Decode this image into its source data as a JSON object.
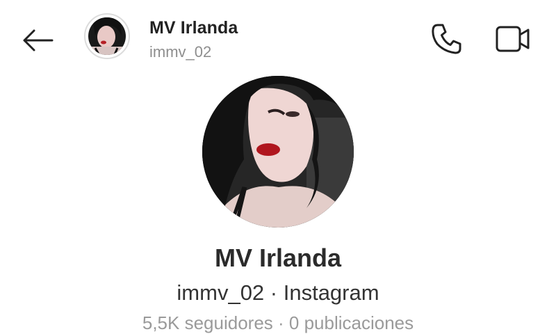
{
  "header": {
    "name": "MV Irlanda",
    "username": "immv_02",
    "icons": {
      "back": "arrow-left-icon",
      "call": "phone-icon",
      "video": "video-camera-icon"
    }
  },
  "profile": {
    "name": "MV Irlanda",
    "subtitle": "immv_02 · Instagram",
    "stats": "5,5K seguidores · 0 publicaciones"
  },
  "colors": {
    "text_primary": "#222222",
    "text_secondary": "#8e8e8e",
    "background": "#ffffff"
  }
}
